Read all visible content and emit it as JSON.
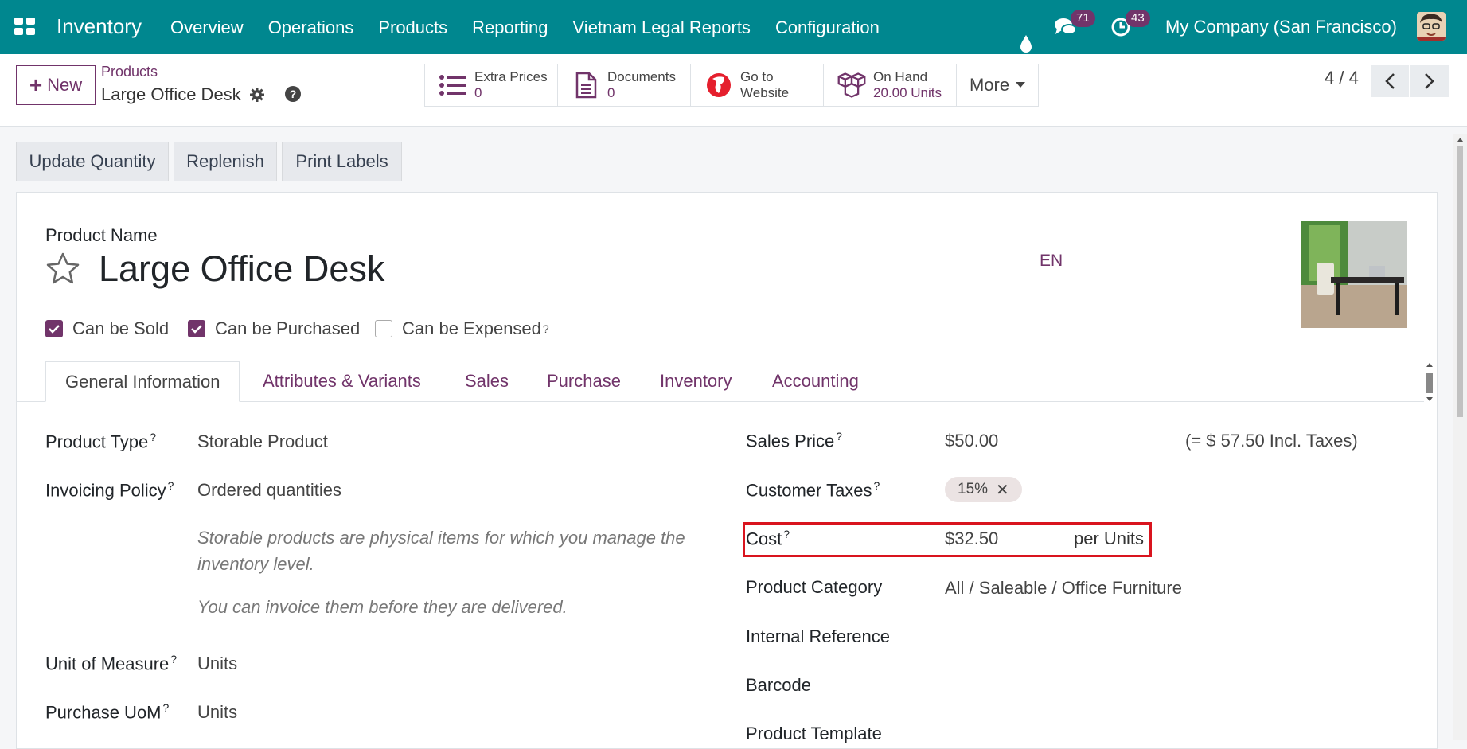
{
  "navbar": {
    "app_title": "Inventory",
    "menu": [
      "Overview",
      "Operations",
      "Products",
      "Reporting",
      "Vietnam Legal Reports",
      "Configuration"
    ],
    "chat_count": "71",
    "activity_count": "43",
    "company": "My Company (San Francisco)",
    "color": "#00878f"
  },
  "control": {
    "new_label": "New",
    "breadcrumb_parent": "Products",
    "breadcrumb_current": "Large Office Desk",
    "stats": [
      {
        "icon": "list-icon",
        "label": "Extra Prices",
        "value": "0"
      },
      {
        "icon": "document-icon",
        "label": "Documents",
        "value": "0"
      },
      {
        "icon": "globe-icon",
        "label": "Go to",
        "value": "Website"
      },
      {
        "icon": "cubes-icon",
        "label": "On Hand",
        "value": "20.00 Units"
      }
    ],
    "more_label": "More",
    "pager": "4 / 4"
  },
  "actions": [
    "Update Quantity",
    "Replenish",
    "Print Labels"
  ],
  "form": {
    "name_label": "Product Name",
    "product_name": "Large Office Desk",
    "lang": "EN",
    "checkboxes": [
      {
        "label": "Can be Sold",
        "checked": true
      },
      {
        "label": "Can be Purchased",
        "checked": true
      },
      {
        "label": "Can be Expensed",
        "checked": false
      }
    ],
    "tabs": [
      "General Information",
      "Attributes & Variants",
      "Sales",
      "Purchase",
      "Inventory",
      "Accounting"
    ],
    "left": {
      "product_type_label": "Product Type",
      "product_type": "Storable Product",
      "invoicing_label": "Invoicing Policy",
      "invoicing": "Ordered quantities",
      "note1": "Storable products are physical items for which you manage the inventory level.",
      "note2": "You can invoice them before they are delivered.",
      "uom_label": "Unit of Measure",
      "uom": "Units",
      "purchase_uom_label": "Purchase UoM",
      "purchase_uom": "Units"
    },
    "right": {
      "sales_price_label": "Sales Price",
      "sales_price": "$50.00",
      "incl_taxes": "(= $ 57.50 Incl. Taxes)",
      "customer_taxes_label": "Customer Taxes",
      "customer_tax": "15%",
      "cost_label": "Cost",
      "cost": "$32.50",
      "cost_unit": "per Units",
      "category_label": "Product Category",
      "category": "All / Saleable / Office Furniture",
      "internal_ref_label": "Internal Reference",
      "barcode_label": "Barcode",
      "template_label": "Product Template"
    }
  }
}
